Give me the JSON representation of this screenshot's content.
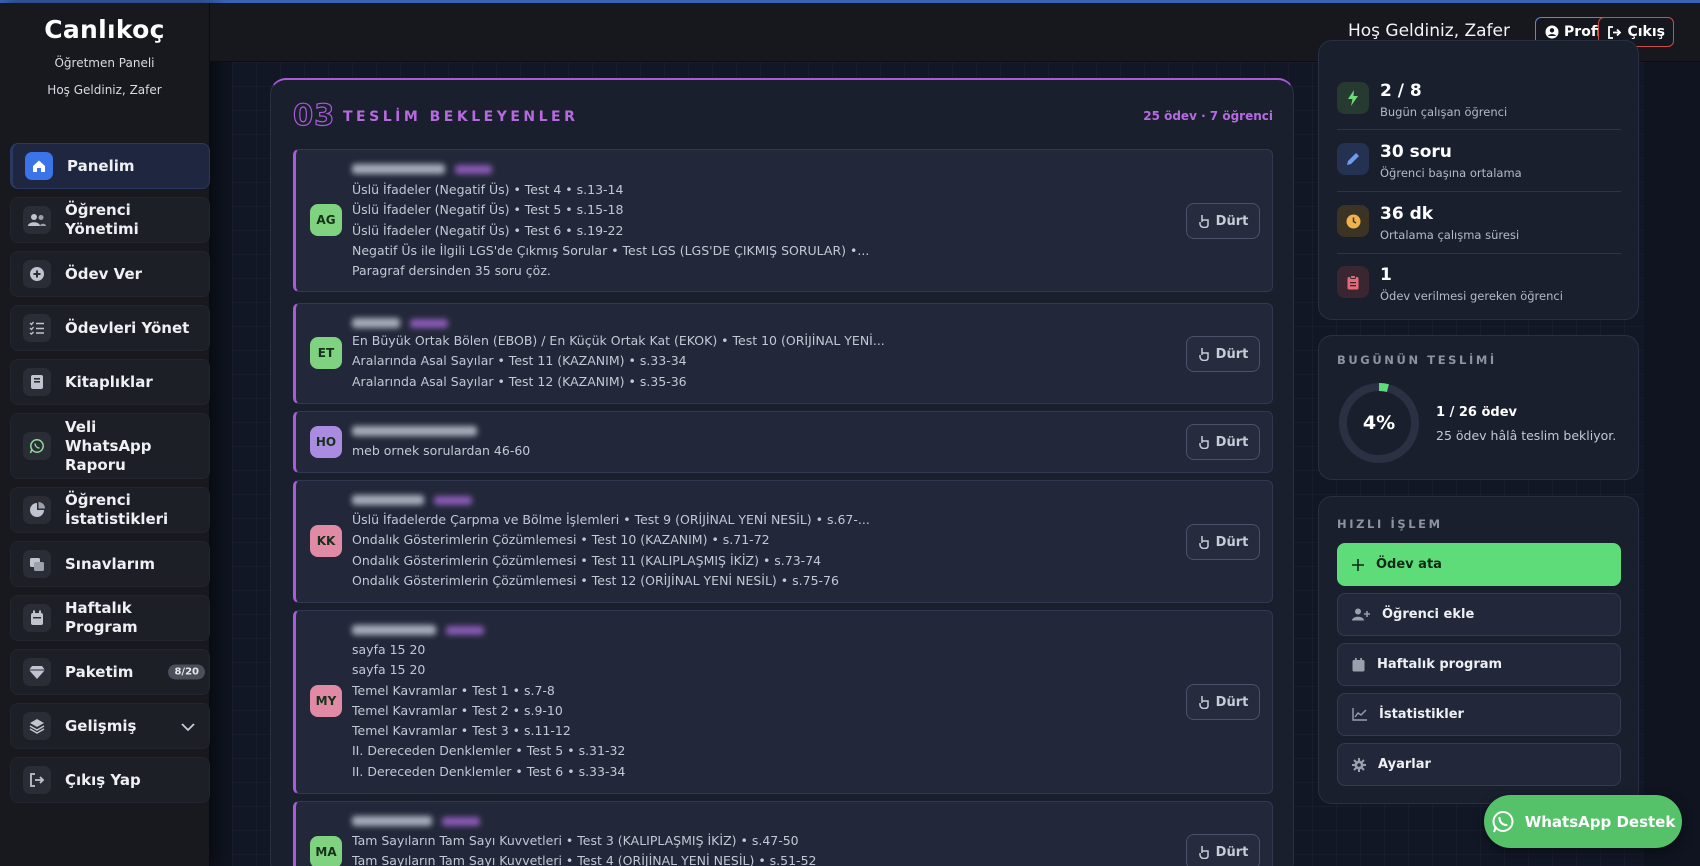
{
  "sidebar": {
    "brand": "Canlıkoç",
    "subtitle": "Öğretmen Paneli",
    "greeting": "Hoş Geldiniz, Zafer",
    "items": [
      {
        "label": "Panelim"
      },
      {
        "label": "Öğrenci Yönetimi"
      },
      {
        "label": "Ödev Ver"
      },
      {
        "label": "Ödevleri Yönet"
      },
      {
        "label": "Kitaplıklar"
      },
      {
        "label": "Veli WhatsApp Raporu"
      },
      {
        "label": "Öğrenci İstatistikleri"
      },
      {
        "label": "Sınavlarım"
      },
      {
        "label": "Haftalık Program"
      },
      {
        "label": "Paketim",
        "badge": "8/20"
      },
      {
        "label": "Gelişmiş"
      },
      {
        "label": "Çıkış Yap"
      }
    ]
  },
  "header": {
    "greeting": "Hoş Geldiniz, Zafer",
    "profile_label": "Profil",
    "logout_label": "Çıkış"
  },
  "pending": {
    "number": "03",
    "title": "TESLİM BEKLEYENLER",
    "meta": "25 ödev · 7 öğrenci",
    "nudge_label": "Dürt",
    "cards": [
      {
        "initials": "AG",
        "color": "#7fd27f",
        "lines": [
          "Üslü İfadeler (Negatif Üs) • Test 4 • s.13-14",
          "Üslü İfadeler (Negatif Üs) • Test 5 • s.15-18",
          "Üslü İfadeler (Negatif Üs) • Test 6 • s.19-22",
          "Negatif Üs ile İlgili LGS'de Çıkmış Sorular • Test LGS (LGS'DE ÇIKMIŞ SORULAR) •...",
          "Paragraf dersinden 35 soru çöz."
        ]
      },
      {
        "initials": "ET",
        "color": "#7fd27f",
        "lines": [
          "En Büyük Ortak Bölen (EBOB) / En Küçük Ortak Kat (EKOK) • Test 10 (ORİJİNAL YENİ...",
          "Aralarında Asal Sayılar • Test 11 (KAZANIM) • s.33-34",
          "Aralarında Asal Sayılar • Test 12 (KAZANIM) • s.35-36"
        ]
      },
      {
        "initials": "HO",
        "color": "#a98be0",
        "lines": [
          "meb ornek sorulardan 46-60"
        ]
      },
      {
        "initials": "KK",
        "color": "#e08aa6",
        "lines": [
          "Üslü İfadelerde Çarpma ve Bölme İşlemleri • Test 9 (ORİJİNAL YENİ NESİL) • s.67-...",
          "Ondalık Gösterimlerin Çözümlemesi • Test 10 (KAZANIM) • s.71-72",
          "Ondalık Gösterimlerin Çözümlemesi • Test 11 (KALIPLAŞMIŞ İKİZ) • s.73-74",
          "Ondalık Gösterimlerin Çözümlemesi • Test 12 (ORİJİNAL YENİ NESİL) • s.75-76"
        ]
      },
      {
        "initials": "MY",
        "color": "#e08aa6",
        "lines": [
          "sayfa 15 20",
          "sayfa 15 20",
          "Temel Kavramlar • Test 1 • s.7-8",
          "Temel Kavramlar • Test 2 • s.9-10",
          "Temel Kavramlar • Test 3 • s.11-12",
          "II. Dereceden Denklemler • Test 5 • s.31-32",
          "II. Dereceden Denklemler • Test 6 • s.33-34"
        ]
      },
      {
        "initials": "MA",
        "color": "#7fd27f",
        "lines": [
          "Tam Sayıların Tam Sayı Kuvvetleri • Test 3 (KALIPLAŞMIŞ İKİZ) • s.47-50",
          "Tam Sayıların Tam Sayı Kuvvetleri • Test 4 (ORİJİNAL YENİ NESİL) • s.51-52"
        ]
      }
    ]
  },
  "stats": [
    {
      "value": "2 / 8",
      "label": "Bugün çalışan öğrenci",
      "icon": "bolt-icon",
      "color": "#6fdc7a"
    },
    {
      "value": "30 soru",
      "label": "Öğrenci başına ortalama",
      "icon": "pencil-icon",
      "color": "#6f9cf0"
    },
    {
      "value": "36 dk",
      "label": "Ortalama çalışma süresi",
      "icon": "clock-icon",
      "color": "#f0b24a"
    },
    {
      "value": "1",
      "label": "Ödev verilmesi gereken öğrenci",
      "icon": "clipboard-icon",
      "color": "#e56a7a"
    }
  ],
  "today": {
    "title": "BUGÜNÜN TESLİMİ",
    "percent_label": "4%",
    "progress": 0.04,
    "main": "1 / 26 ödev",
    "sub": "25 ödev hâlâ teslim bekliyor."
  },
  "quick": {
    "title": "HIZLI İŞLEM",
    "items": [
      {
        "label": "Ödev ata"
      },
      {
        "label": "Öğrenci ekle"
      },
      {
        "label": "Haftalık program"
      },
      {
        "label": "İstatistikler"
      },
      {
        "label": "Ayarlar"
      }
    ]
  },
  "whatsapp_label": "WhatsApp Destek",
  "colors": {
    "accent": "#a95bd8",
    "primary": "#3b74e8",
    "success": "#5fdc7a",
    "danger": "#d04a4a"
  }
}
